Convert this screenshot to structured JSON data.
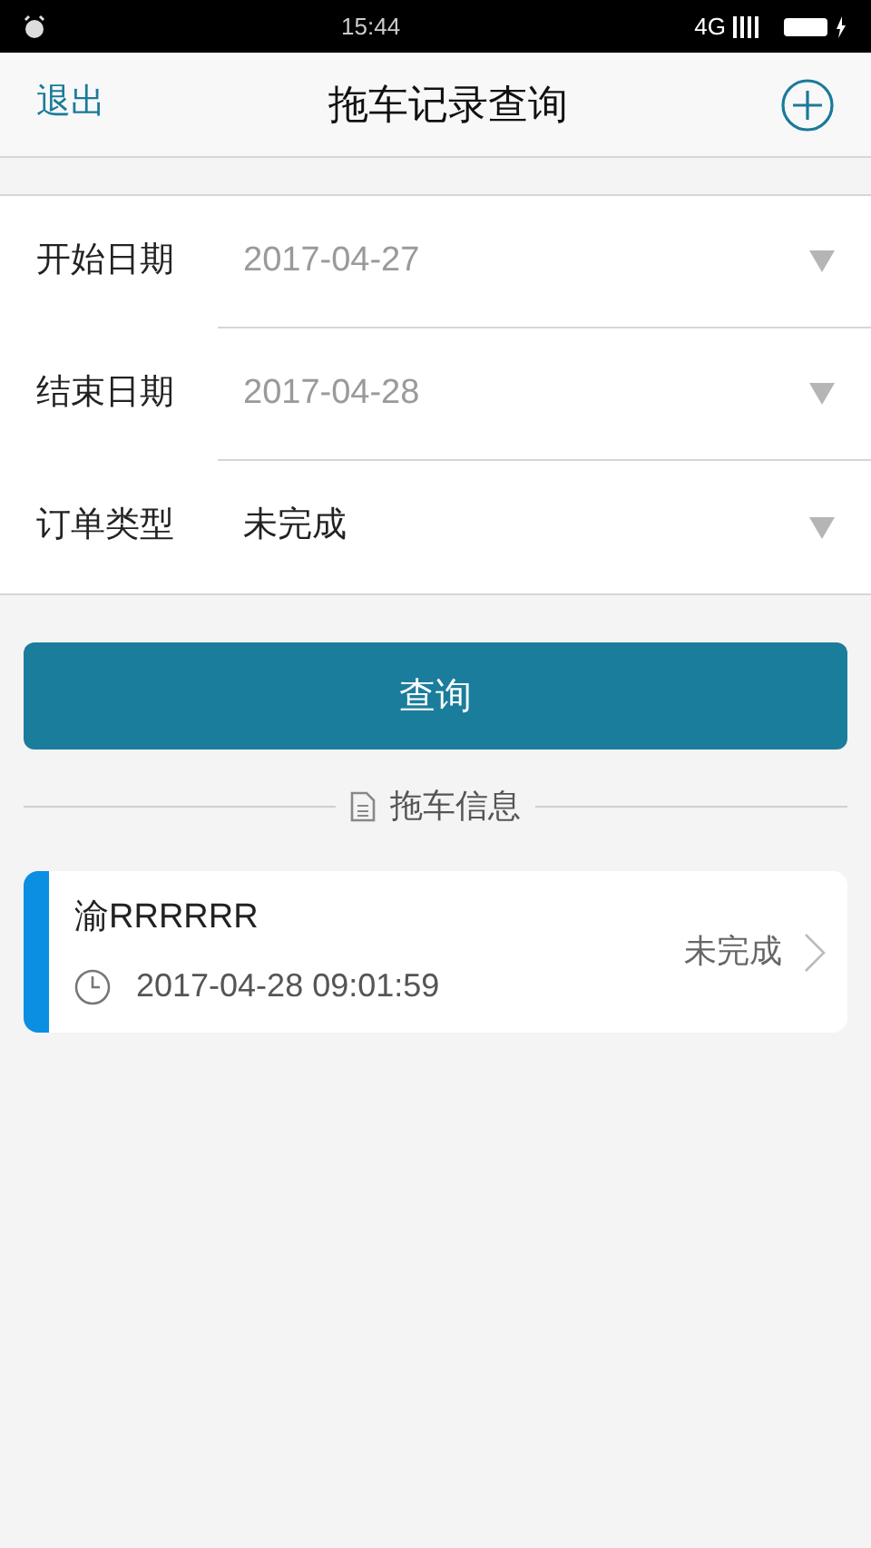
{
  "status_bar": {
    "time": "15:44",
    "network": "4G"
  },
  "header": {
    "back": "退出",
    "title": "拖车记录查询"
  },
  "form": [
    {
      "label": "开始日期",
      "value": "2017-04-27",
      "kind": "date"
    },
    {
      "label": "结束日期",
      "value": "2017-04-28",
      "kind": "date"
    },
    {
      "label": "订单类型",
      "value": "未完成",
      "kind": "select"
    }
  ],
  "query_button": "查询",
  "section_title": "拖车信息",
  "records": [
    {
      "plate": "渝RRRRRR",
      "time": "2017-04-28 09:01:59",
      "status": "未完成",
      "color": "#0a8fe3"
    }
  ]
}
